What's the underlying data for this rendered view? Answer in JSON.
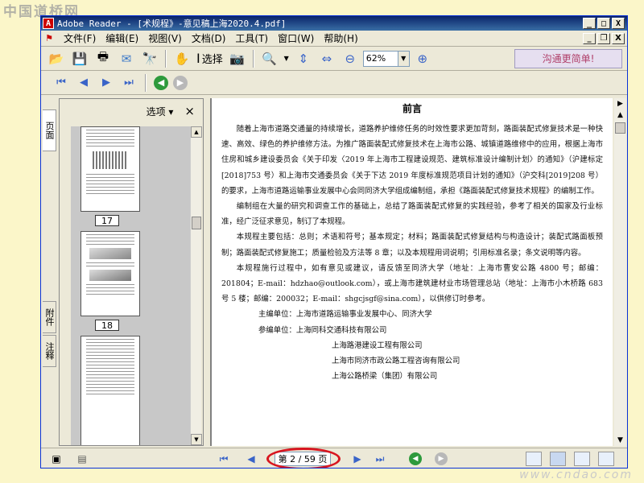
{
  "watermark": {
    "top_left": "中国道桥网",
    "bottom_right": "www.cndao.com"
  },
  "titlebar": {
    "app_icon": "acrobat-logo",
    "title": "Adobe Reader - [术规程》-意见稿上海2020.4.pdf]",
    "min": "_",
    "max": "□",
    "close": "X"
  },
  "menubar": {
    "items": [
      "文件(F)",
      "编辑(E)",
      "视图(V)",
      "文档(D)",
      "工具(T)",
      "窗口(W)",
      "帮助(H)"
    ],
    "min": "_",
    "restore": "❐",
    "close": "X"
  },
  "toolbar": {
    "select_label": "选择",
    "zoom_value": "62%",
    "promo": "沟通更简单!"
  },
  "sidepanel": {
    "options_label": "选项 ▾",
    "close": "×",
    "tabs": [
      "页面",
      "附件",
      "注释"
    ],
    "thumb_labels": [
      "17",
      "18"
    ]
  },
  "document": {
    "title": "前言",
    "paragraphs": [
      "随着上海市道路交通量的持续增长，道路养护维修任务的时效性要求更加苛刻，路面装配式修复技术是一种快速、高效、绿色的养护维修方法。为推广路面装配式修复技术在上海市公路、城镇道路维修中的应用，根据上海市住房和城乡建设委员会《关于印发〈2019 年上海市工程建设规范、建筑标准设计编制计划〉的通知》（沪建标定[2018]753 号）和上海市交通委员会《关于下达 2019 年度标准规范项目计划的通知》（沪交科[2019]208 号）的要求，上海市道路运输事业发展中心会同同济大学组成编制组，承担《路面装配式修复技术规程》的编制工作。",
      "编制组在大量的研究和调查工作的基础上，总结了路面装配式修复的实践经验，参考了相关的国家及行业标准，经广泛征求意见，制订了本规程。",
      "本规程主要包括：总则；术语和符号；基本规定；材料；路面装配式修复结构与构造设计；装配式路面板预制；路面装配式修复施工；质量检验及方法等 8 章；以及本规程用词说明；引用标准名录；条文说明等内容。",
      "本规程施行过程中，如有意见或建议，请反馈至同济大学（地址：上海市曹安公路 4800 号；邮编：201804；E-mail：hdzhao@outlook.com），或上海市建筑建材业市场管理总站（地址：上海市小木桥路 683 号 5 楼；邮编：200032；E-mail：shgcjsgf@sina.com），以供修订时参考。"
    ],
    "chief_unit": "主编单位：上海市道路运输事业发展中心、同济大学",
    "participants_label": "参编单位：上海同科交通科技有限公司",
    "participants": [
      "上海路港建设工程有限公司",
      "上海市同济市政公路工程咨询有限公司",
      "上海公路桥梁（集团）有限公司"
    ]
  },
  "statusbar": {
    "page_indicator": "第 2 / 59 页"
  }
}
